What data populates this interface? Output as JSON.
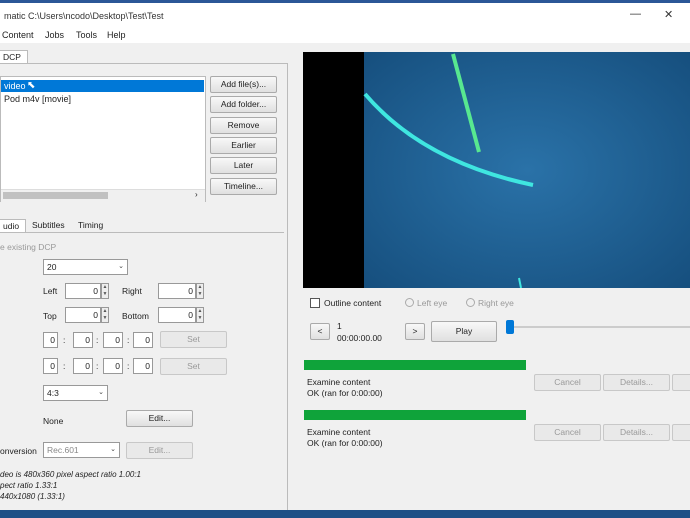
{
  "window": {
    "title": "matic   C:\\Users\\ncodo\\Desktop\\Test\\Test",
    "minimize": "—",
    "close": "✕"
  },
  "menu": [
    "Content",
    "Jobs",
    "Tools",
    "Help"
  ],
  "main_tab": "DCP",
  "content_list": {
    "items": [
      "video",
      "Pod m4v [movie]"
    ],
    "selected_index": 0
  },
  "content_buttons": [
    "Add file(s)...",
    "Add folder...",
    "Remove",
    "Earlier",
    "Later",
    "Timeline..."
  ],
  "sub_tabs": [
    "udio",
    "Subtitles",
    "Timing"
  ],
  "settings": {
    "use_existing_dcp": "e existing DCP",
    "frame_rate": "20",
    "left_label": "Left",
    "left_value": "0",
    "right_label": "Right",
    "right_value": "0",
    "top_label": "Top",
    "top_value": "0",
    "bottom_label": "Bottom",
    "bottom_value": "0",
    "time_row1": [
      "0",
      "0",
      "0",
      "0"
    ],
    "time_row2": [
      "0",
      "0",
      "0",
      "0"
    ],
    "set_label": "Set",
    "scale": "4:3",
    "filters_value": "None",
    "edit_label": "Edit...",
    "conversion_label": "onversion",
    "conversion_value": "Rec.601",
    "conversion_edit": "Edit...",
    "info_lines": [
      "deo is 480x360 pixel aspect ratio 1.00:1",
      "pect ratio 1.33:1",
      "440x1080 (1.33:1)"
    ]
  },
  "viewer": {
    "outline_content": "Outline content",
    "left_eye": "Left eye",
    "right_eye": "Right eye",
    "frame_number": "1",
    "timecode": "00:00:00.00",
    "prev": "<",
    "next": ">",
    "play": "Play",
    "slider_position": 0
  },
  "jobs": [
    {
      "progress": 1.0,
      "title": "Examine content",
      "status": "OK (ran for 0:00:00)",
      "cancel": "Cancel",
      "details": "Details..."
    },
    {
      "progress": 1.0,
      "title": "Examine content",
      "status": "OK (ran for 0:00:00)",
      "cancel": "Cancel",
      "details": "Details..."
    }
  ],
  "colors": {
    "accent": "#0078d7",
    "progress": "#0fa33a",
    "video_bg": "#1d5d8f"
  }
}
